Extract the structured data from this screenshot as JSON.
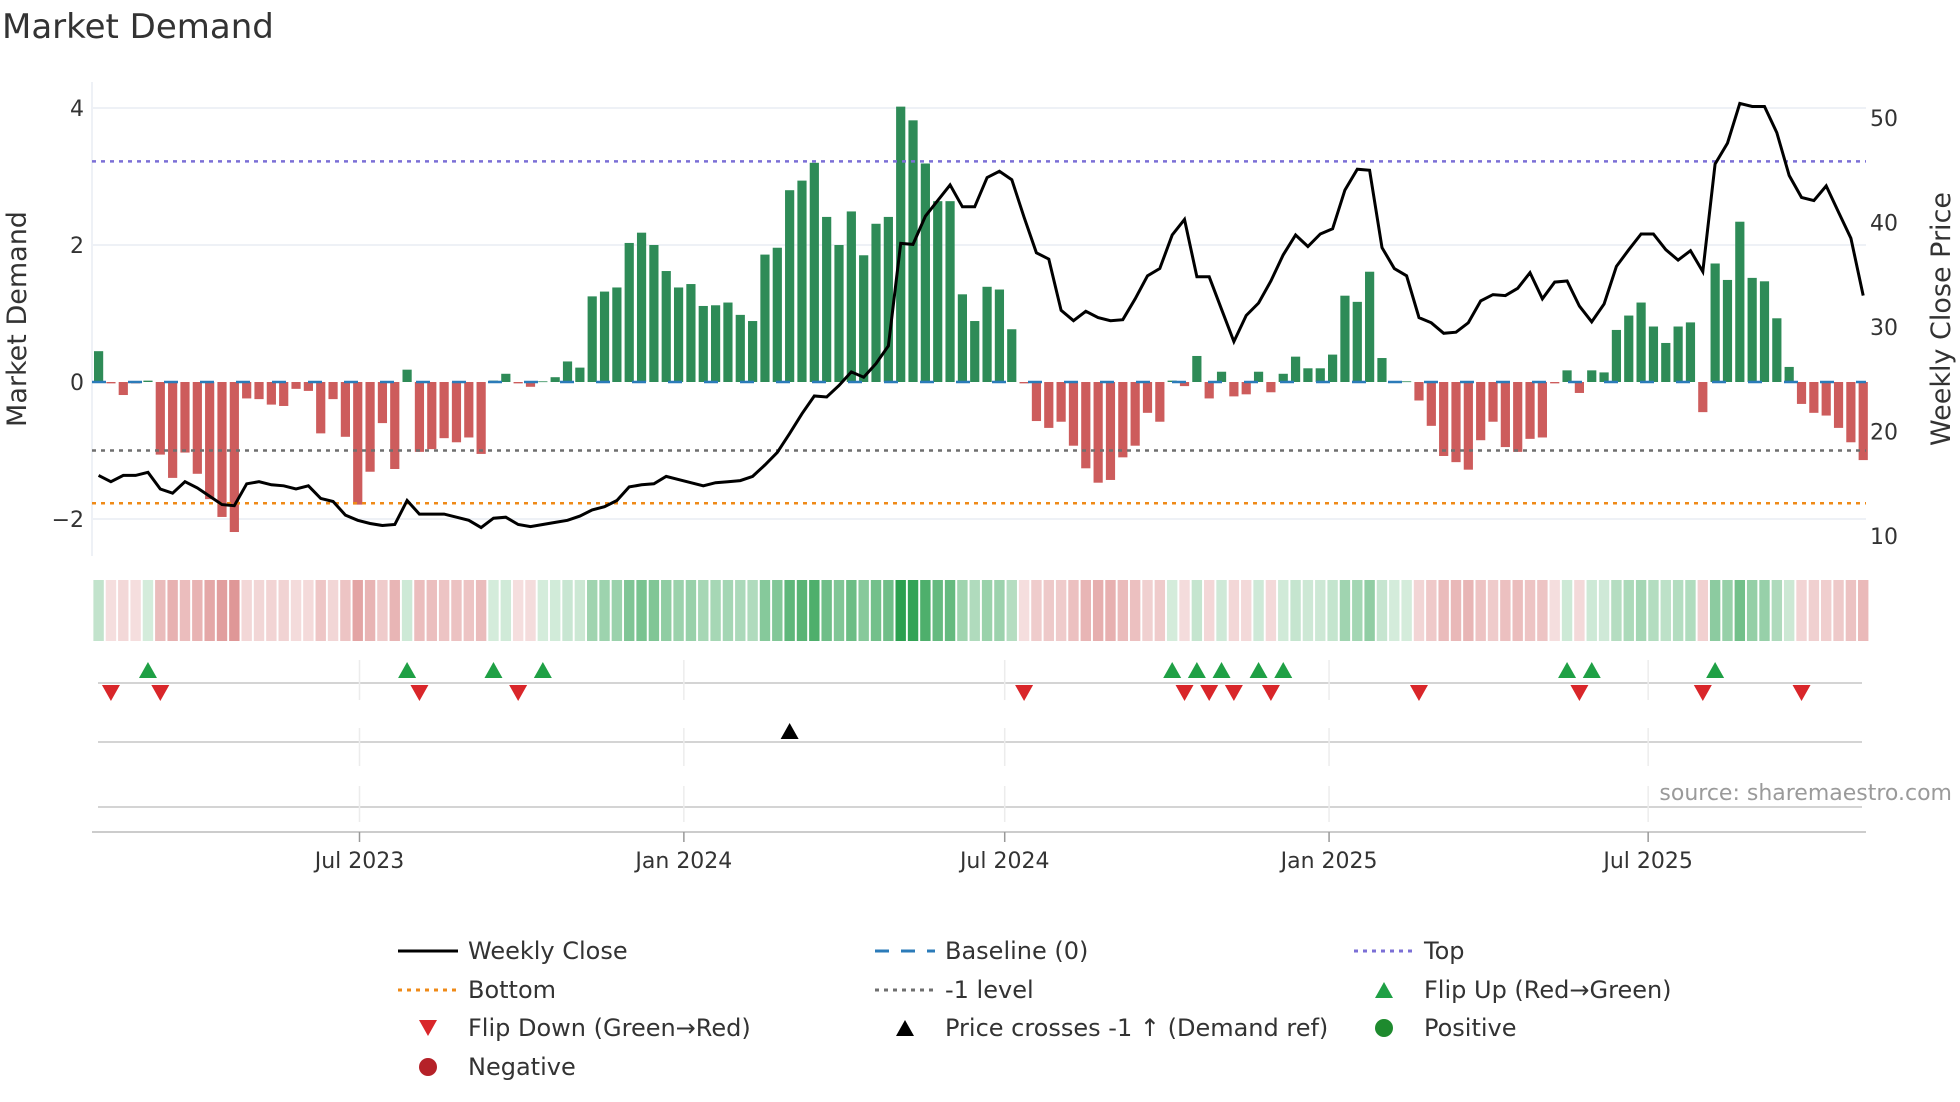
{
  "chart_data": {
    "type": "bar",
    "title": "Market Demand",
    "ylabel": "Market Demand",
    "y2label": "Weekly Close Price",
    "ylim": [
      -2.45,
      4.4
    ],
    "y2lim": [
      8,
      54
    ],
    "yticks": [
      "4",
      "2",
      "0",
      "−2"
    ],
    "ytick_values": [
      4,
      2,
      0,
      -2
    ],
    "y2ticks": [
      "50",
      "40",
      "30",
      "20",
      "10"
    ],
    "y2tick_values": [
      50,
      40,
      30,
      20,
      10
    ],
    "x_start": "2023-02-03",
    "x_step_days": 7,
    "xticks": [
      {
        "label": "Jul 2023",
        "date": "2023-07-01"
      },
      {
        "label": "Jan 2024",
        "date": "2024-01-01"
      },
      {
        "label": "Jul 2024",
        "date": "2024-07-01"
      },
      {
        "label": "Jan 2025",
        "date": "2025-01-01"
      },
      {
        "label": "Jul 2025",
        "date": "2025-07-01"
      }
    ],
    "grid": true,
    "demand": [
      0.45,
      -0.02,
      -0.19,
      -0.02,
      0.02,
      -1.06,
      -1.4,
      -1.03,
      -1.34,
      -1.71,
      -1.97,
      -2.19,
      -0.24,
      -0.25,
      -0.33,
      -0.35,
      -0.1,
      -0.13,
      -0.75,
      -0.25,
      -0.8,
      -1.79,
      -1.31,
      -0.6,
      -1.27,
      0.18,
      -1.02,
      -0.98,
      -0.82,
      -0.88,
      -0.81,
      -1.05,
      0.02,
      0.12,
      -0.02,
      -0.07,
      0.01,
      0.07,
      0.3,
      0.21,
      1.25,
      1.32,
      1.38,
      2.03,
      2.18,
      2.0,
      1.62,
      1.38,
      1.43,
      1.11,
      1.12,
      1.16,
      0.98,
      0.89,
      1.86,
      1.96,
      2.8,
      2.94,
      3.2,
      2.41,
      2.0,
      2.49,
      1.85,
      2.31,
      2.41,
      4.02,
      3.82,
      3.19,
      2.64,
      2.64,
      1.28,
      0.89,
      1.39,
      1.35,
      0.77,
      -0.02,
      -0.57,
      -0.67,
      -0.58,
      -0.93,
      -1.26,
      -1.47,
      -1.43,
      -1.1,
      -0.93,
      -0.45,
      -0.58,
      0.02,
      -0.06,
      0.38,
      -0.24,
      0.15,
      -0.21,
      -0.18,
      0.15,
      -0.15,
      0.12,
      0.37,
      0.2,
      0.2,
      0.4,
      1.26,
      1.17,
      1.61,
      0.35,
      0.01,
      0.01,
      -0.27,
      -0.64,
      -1.08,
      -1.17,
      -1.28,
      -0.85,
      -0.58,
      -0.95,
      -1.02,
      -0.83,
      -0.81,
      -0.02,
      0.17,
      -0.16,
      0.17,
      0.14,
      0.76,
      0.97,
      1.16,
      0.81,
      0.57,
      0.81,
      0.87,
      -0.44,
      1.73,
      1.49,
      2.34,
      1.52,
      1.47,
      0.93,
      0.22,
      -0.32,
      -0.45,
      -0.49,
      -0.67,
      -0.88,
      -1.14
    ],
    "weekly_close": [
      15.8,
      15.2,
      15.8,
      15.8,
      16.1,
      14.5,
      14.1,
      15.2,
      14.6,
      13.8,
      13.0,
      12.9,
      15.0,
      15.2,
      14.9,
      14.8,
      14.5,
      14.8,
      13.6,
      13.3,
      12.0,
      11.5,
      11.2,
      11.0,
      11.1,
      13.4,
      12.1,
      12.1,
      12.1,
      11.8,
      11.5,
      10.8,
      11.7,
      11.8,
      11.1,
      10.9,
      11.1,
      11.3,
      11.5,
      11.9,
      12.5,
      12.8,
      13.4,
      14.7,
      14.9,
      15.0,
      15.7,
      15.4,
      15.1,
      14.8,
      15.1,
      15.2,
      15.3,
      15.7,
      16.8,
      18.0,
      19.8,
      21.7,
      23.4,
      23.3,
      24.4,
      25.7,
      25.2,
      26.5,
      28.2,
      38.0,
      37.9,
      40.6,
      42.1,
      43.6,
      41.5,
      41.5,
      44.3,
      44.9,
      44.1,
      40.5,
      37.1,
      36.5,
      31.6,
      30.6,
      31.5,
      30.9,
      30.6,
      30.7,
      32.7,
      34.9,
      35.6,
      38.8,
      40.3,
      34.8,
      34.8,
      31.7,
      28.6,
      31.1,
      32.3,
      34.4,
      36.9,
      38.8,
      37.7,
      38.9,
      39.4,
      43.1,
      45.1,
      45.0,
      37.6,
      35.6,
      34.9,
      30.9,
      30.4,
      29.4,
      29.5,
      30.4,
      32.5,
      33.1,
      33.0,
      33.7,
      35.2,
      32.7,
      34.3,
      34.4,
      32.0,
      30.5,
      32.2,
      35.8,
      37.4,
      38.9,
      38.9,
      37.4,
      36.4,
      37.3,
      35.3,
      45.6,
      47.6,
      51.4,
      51.1,
      51.1,
      48.6,
      44.5,
      42.4,
      42.1,
      43.5,
      41.0,
      38.5,
      33.0
    ],
    "levels": {
      "top": 3.22,
      "bottom": -1.77,
      "minus_one": -1,
      "baseline": 0
    },
    "price_cross_index": 56,
    "legend_position": "bottom-center",
    "legend": [
      {
        "label": "Weekly Close",
        "symbol": "line-solid"
      },
      {
        "label": "Baseline (0)",
        "symbol": "line-dash"
      },
      {
        "label": "Top",
        "symbol": "line-dot-top"
      },
      {
        "label": "Bottom",
        "symbol": "line-dot-bottom"
      },
      {
        "label": "-1 level",
        "symbol": "line-dot-gray"
      },
      {
        "label": "Flip Up (Red→Green)",
        "symbol": "triangle-up-green"
      },
      {
        "label": "Flip Down (Green→Red)",
        "symbol": "triangle-down-red"
      },
      {
        "label": "Price crosses -1 ↑ (Demand ref)",
        "symbol": "triangle-up-black"
      },
      {
        "label": "Positive",
        "symbol": "circle-green"
      },
      {
        "label": "Negative",
        "symbol": "circle-red"
      }
    ],
    "source": "source: sharemaestro.com"
  },
  "colors": {
    "positive_bar": "#2e8b57",
    "negative_bar": "#cd5c5c",
    "baseline": "#2b7bb9",
    "top": "#7b6fd6",
    "bottom": "#ef8a17",
    "minus_one": "#6f6f6f",
    "price": "#000000",
    "flip_up": "#1fa045",
    "flip_down": "#d9262a",
    "positive_dot": "#1e8a2e",
    "negative_dot": "#b52128",
    "grid": "#eef1f6"
  }
}
